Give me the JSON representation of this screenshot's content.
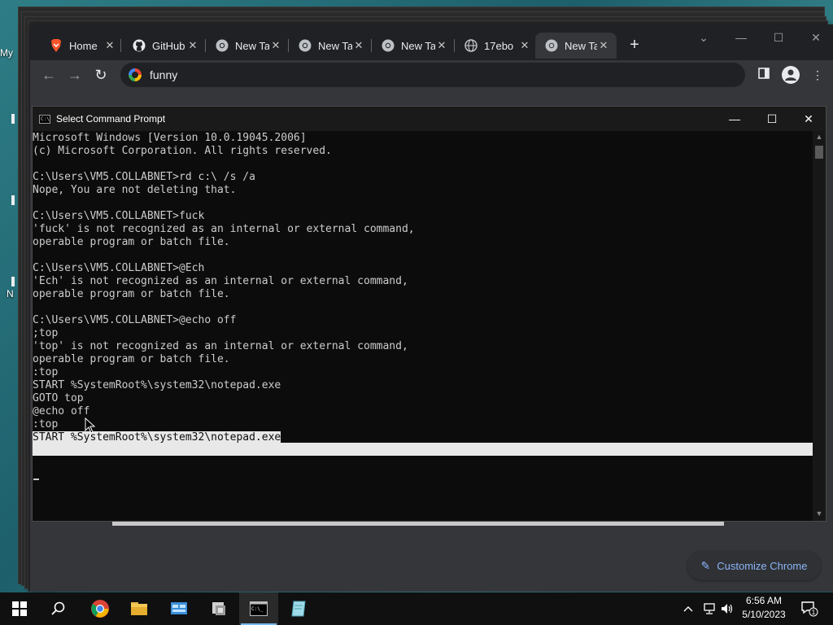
{
  "desktop": {
    "icon_labels": [
      "My",
      "N"
    ]
  },
  "browser": {
    "tabs": [
      {
        "label": "Home",
        "icon": "brave-lion-icon"
      },
      {
        "label": "GitHub",
        "icon": "github-icon"
      },
      {
        "label": "New Ta",
        "icon": "chrome-icon"
      },
      {
        "label": "New Ta",
        "icon": "chrome-icon"
      },
      {
        "label": "New Ta",
        "icon": "chrome-icon"
      },
      {
        "label": "17ebo",
        "icon": "globe-icon"
      },
      {
        "label": "New Ta",
        "icon": "chrome-icon"
      }
    ],
    "active_tab_index": 6,
    "new_tab_symbol": "+",
    "address": "funny",
    "customize_label": "Customize Chrome"
  },
  "cmd": {
    "title": "Select Command Prompt",
    "lines": [
      "Microsoft Windows [Version 10.0.19045.2006]",
      "(c) Microsoft Corporation. All rights reserved.",
      "",
      "C:\\Users\\VM5.COLLABNET>rd c:\\ /s /a",
      "Nope, You are not deleting that.",
      "",
      "C:\\Users\\VM5.COLLABNET>fuck",
      "'fuck' is not recognized as an internal or external command,",
      "operable program or batch file.",
      "",
      "C:\\Users\\VM5.COLLABNET>@Ech",
      "'Ech' is not recognized as an internal or external command,",
      "operable program or batch file.",
      "",
      "C:\\Users\\VM5.COLLABNET>@echo off",
      ";top",
      "'top' is not recognized as an internal or external command,",
      "operable program or batch file.",
      ":top",
      "START %SystemRoot%\\system32\\notepad.exe",
      "GOTO top",
      "@echo off",
      ":top",
      "START %SystemRoot%\\system32\\notepad.exe"
    ],
    "selected_line_start": 22
  },
  "taskbar": {
    "time": "6:56 AM",
    "date": "5/10/2023",
    "notification_count": "1",
    "apps": [
      "windows-start-icon",
      "search-icon",
      "chrome-icon",
      "file-explorer-icon",
      "control-panel-icon",
      "installer-icon",
      "command-prompt-icon",
      "notepad-icon"
    ]
  }
}
